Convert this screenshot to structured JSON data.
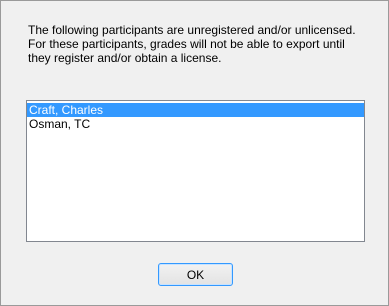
{
  "dialog": {
    "message_lines": [
      "The following participants are unregistered and/or unlicensed.",
      "For these participants, grades will not be able to export until",
      "they register and/or obtain a license."
    ],
    "participants": [
      "Craft, Charles",
      "Osman, TC"
    ],
    "selected_index": 0,
    "ok_label": "OK"
  }
}
